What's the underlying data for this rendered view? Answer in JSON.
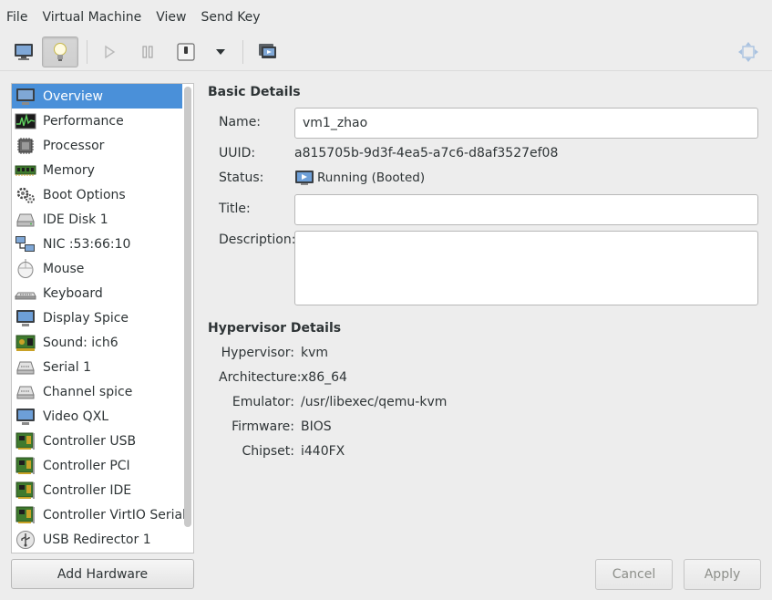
{
  "menu": [
    "File",
    "Virtual Machine",
    "View",
    "Send Key"
  ],
  "toolbar": {
    "buttons": [
      {
        "name": "console-icon",
        "active": false
      },
      {
        "name": "details-bulb-icon",
        "active": true
      },
      {
        "name": "run-icon",
        "active": false
      },
      {
        "name": "pause-icon",
        "active": false
      },
      {
        "name": "shutdown-icon",
        "active": false
      },
      {
        "name": "shutdown-menu-arrow-icon",
        "active": false
      },
      {
        "name": "snapshots-icon",
        "active": false
      },
      {
        "name": "fullscreen-icon",
        "active": false
      }
    ]
  },
  "sidebar": {
    "items": [
      {
        "label": "Overview",
        "icon": "monitor-icon",
        "selected": true
      },
      {
        "label": "Performance",
        "icon": "performance-icon"
      },
      {
        "label": "Processor",
        "icon": "cpu-icon"
      },
      {
        "label": "Memory",
        "icon": "memory-icon"
      },
      {
        "label": "Boot Options",
        "icon": "gear-icon"
      },
      {
        "label": "IDE Disk 1",
        "icon": "disk-icon"
      },
      {
        "label": "NIC :53:66:10",
        "icon": "network-icon"
      },
      {
        "label": "Mouse",
        "icon": "mouse-icon"
      },
      {
        "label": "Keyboard",
        "icon": "keyboard-icon"
      },
      {
        "label": "Display Spice",
        "icon": "display-icon"
      },
      {
        "label": "Sound: ich6",
        "icon": "sound-card-icon"
      },
      {
        "label": "Serial 1",
        "icon": "serial-icon"
      },
      {
        "label": "Channel spice",
        "icon": "channel-icon"
      },
      {
        "label": "Video QXL",
        "icon": "video-icon"
      },
      {
        "label": "Controller USB",
        "icon": "controller-card-icon"
      },
      {
        "label": "Controller PCI",
        "icon": "controller-card-icon"
      },
      {
        "label": "Controller IDE",
        "icon": "controller-card-icon"
      },
      {
        "label": "Controller VirtIO Serial",
        "icon": "controller-card-icon"
      },
      {
        "label": "USB Redirector 1",
        "icon": "usb-icon"
      }
    ],
    "add_hardware_label": "Add Hardware"
  },
  "basic": {
    "title": "Basic Details",
    "name_label": "Name:",
    "name_value": "vm1_zhao",
    "uuid_label": "UUID:",
    "uuid_value": "a815705b-9d3f-4ea5-a7c6-d8af3527ef08",
    "status_label": "Status:",
    "status_value": "Running (Booted)",
    "title_label": "Title:",
    "title_value": "",
    "description_label": "Description:",
    "description_value": ""
  },
  "hypervisor": {
    "title": "Hypervisor Details",
    "hypervisor_label": "Hypervisor:",
    "hypervisor_value": "kvm",
    "architecture_label": "Architecture:",
    "architecture_value": "x86_64",
    "emulator_label": "Emulator:",
    "emulator_value": "/usr/libexec/qemu-kvm",
    "firmware_label": "Firmware:",
    "firmware_value": "BIOS",
    "chipset_label": "Chipset:",
    "chipset_value": "i440FX"
  },
  "actions": {
    "cancel_label": "Cancel",
    "apply_label": "Apply"
  },
  "colors": {
    "selection": "#4a90d9",
    "window_bg": "#ededed"
  }
}
